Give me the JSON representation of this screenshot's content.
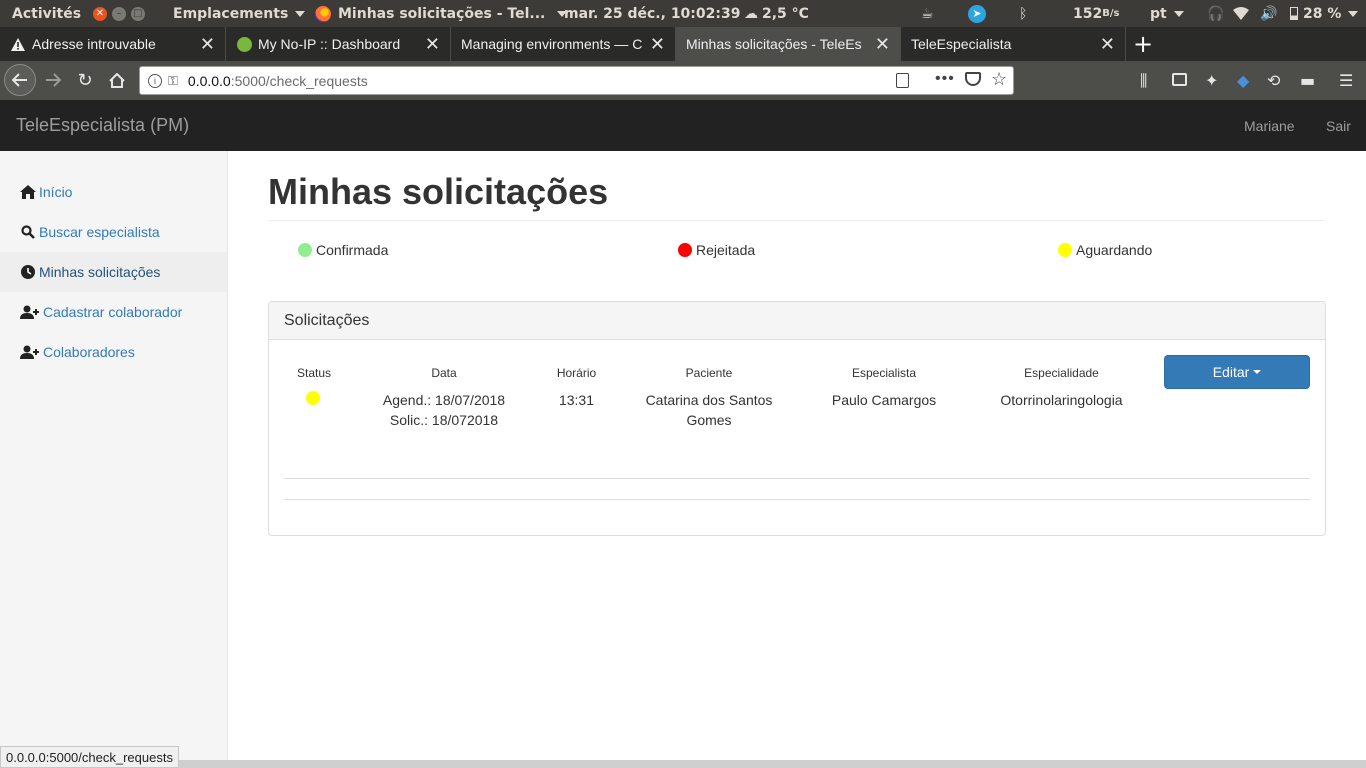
{
  "system_bar": {
    "activities": "Activités",
    "places": "Emplacements",
    "app_title": "Minhas solicitações - Tel...",
    "datetime": "mar. 25 déc., 10:02:39",
    "weather": "2,5 °C",
    "net_speed": "152",
    "net_unit": "B/s",
    "lang": "pt",
    "battery": "28 %"
  },
  "tabs": [
    {
      "label": "Adresse introuvable",
      "icon": "warning-icon",
      "active": false
    },
    {
      "label": "My No-IP :: Dashboard",
      "icon": "noip-icon",
      "active": false
    },
    {
      "label": "Managing environments — C",
      "icon": "",
      "active": false
    },
    {
      "label": "Minhas solicitações - TeleEs",
      "icon": "",
      "active": true
    },
    {
      "label": "TeleEspecialista",
      "icon": "",
      "active": false
    }
  ],
  "url": {
    "host": "0.0.0.0",
    "path": ":5000/check_requests"
  },
  "app": {
    "brand": "TeleEspecialista (PM)",
    "user": "Mariane",
    "logout": "Sair"
  },
  "sidebar": {
    "items": [
      {
        "label": "Início",
        "icon": "home-icon"
      },
      {
        "label": "Buscar especialista",
        "icon": "search-icon"
      },
      {
        "label": "Minhas solicitações",
        "icon": "clock-icon"
      },
      {
        "label": "Cadastrar colaborador",
        "icon": "add-user-icon"
      },
      {
        "label": "Colaboradores",
        "icon": "add-user-icon"
      }
    ]
  },
  "main": {
    "title": "Minhas solicitações",
    "legend": [
      {
        "label": "Confirmada",
        "color": "#90ee90"
      },
      {
        "label": "Rejeitada",
        "color": "#ff0000"
      },
      {
        "label": "Aguardando",
        "color": "#ffff00"
      }
    ],
    "panel_title": "Solicitações",
    "columns": [
      "Status",
      "Data",
      "Horário",
      "Paciente",
      "Especialista",
      "Especialidade"
    ],
    "rows": [
      {
        "status_color": "#ffff00",
        "date_line1": "Agend.: 18/07/2018",
        "date_line2": "Solic.: 18/072018",
        "time": "13:31",
        "patient_line1": "Catarina dos Santos",
        "patient_line2": "Gomes",
        "specialist": "Paulo Camargos",
        "specialty": "Otorrinolaringologia"
      }
    ],
    "edit_button": "Editar"
  },
  "status_url": "0.0.0.0:5000/check_requests"
}
